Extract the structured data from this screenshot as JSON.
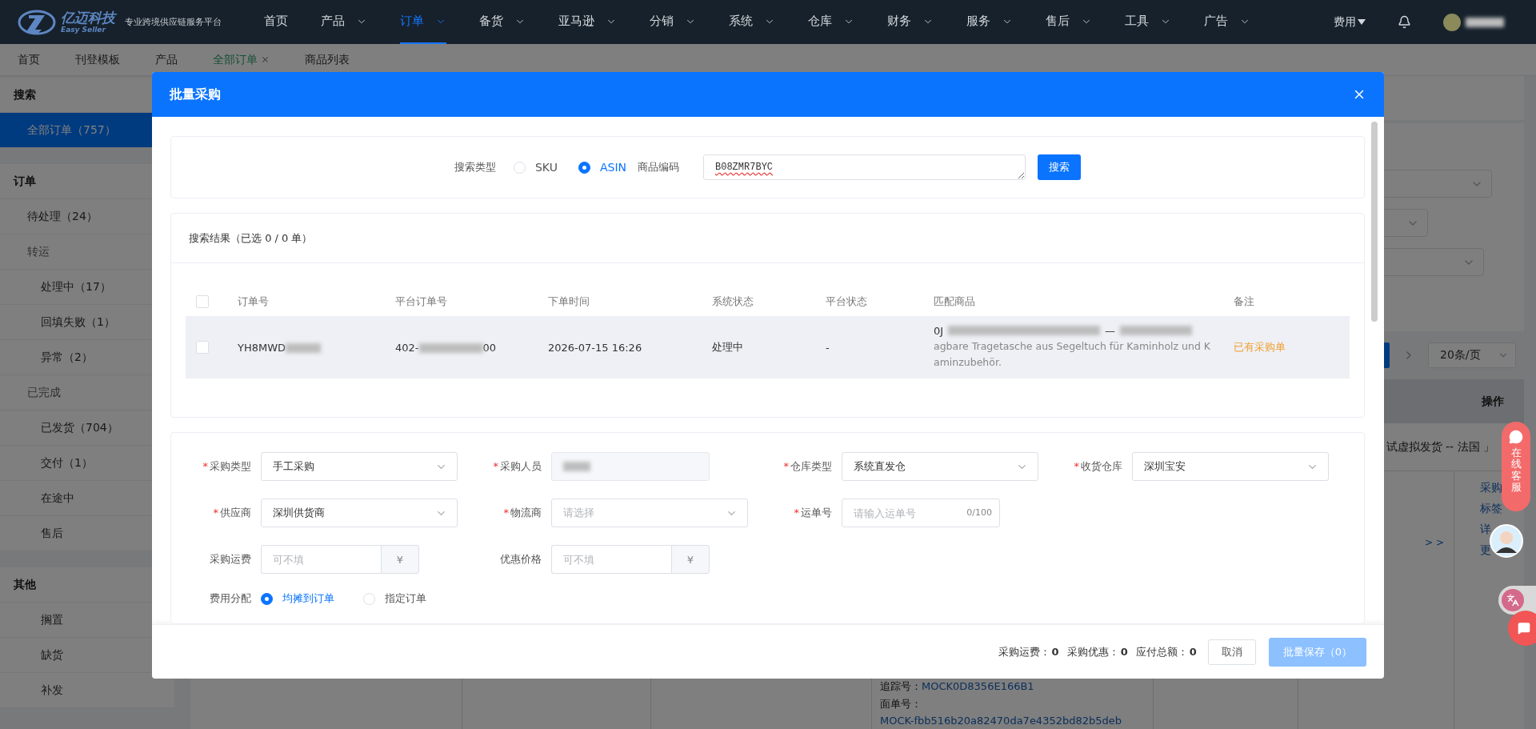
{
  "top_nav": {
    "logo": {
      "name": "亿迈科技",
      "sub": "Easy Seller"
    },
    "slogan": "专业跨境供应链服务平台",
    "items": [
      {
        "label": "首页",
        "dropdown": false,
        "selected": false
      },
      {
        "label": "产品",
        "dropdown": true,
        "selected": false
      },
      {
        "label": "订单",
        "dropdown": true,
        "selected": true
      },
      {
        "label": "备货",
        "dropdown": true,
        "selected": false
      },
      {
        "label": "亚马逊",
        "dropdown": true,
        "selected": false
      },
      {
        "label": "分销",
        "dropdown": true,
        "selected": false
      },
      {
        "label": "系统",
        "dropdown": true,
        "selected": false
      },
      {
        "label": "仓库",
        "dropdown": true,
        "selected": false
      },
      {
        "label": "财务",
        "dropdown": true,
        "selected": false
      },
      {
        "label": "服务",
        "dropdown": true,
        "selected": false
      },
      {
        "label": "售后",
        "dropdown": true,
        "selected": false
      },
      {
        "label": "工具",
        "dropdown": true,
        "selected": false
      },
      {
        "label": "广告",
        "dropdown": true,
        "selected": false
      }
    ],
    "fee_menu": "费用"
  },
  "page_tabs": [
    {
      "label": "首页",
      "selected": false,
      "closable": false
    },
    {
      "label": "刊登模板",
      "selected": false,
      "closable": false
    },
    {
      "label": "产品",
      "selected": false,
      "closable": false
    },
    {
      "label": "全部订单",
      "selected": true,
      "closable": true
    },
    {
      "label": "商品列表",
      "selected": false,
      "closable": false
    }
  ],
  "sidebar": {
    "sections": [
      {
        "title": "搜索",
        "items": [
          {
            "label": "全部订单（757）",
            "kind": "item",
            "selected": true
          }
        ]
      },
      {
        "title": "订单",
        "items": [
          {
            "label": "待处理（24）",
            "kind": "item",
            "selected": false
          },
          {
            "label": "转运",
            "kind": "group",
            "children": [
              {
                "label": "处理中（17）",
                "selected": false
              },
              {
                "label": "回填失败（1）",
                "selected": false
              },
              {
                "label": "异常（2）",
                "selected": false
              }
            ]
          },
          {
            "label": "已完成",
            "kind": "group",
            "children": [
              {
                "label": "已发货（704）",
                "selected": false
              },
              {
                "label": "交付（1）",
                "selected": false
              },
              {
                "label": "在途中",
                "selected": false
              },
              {
                "label": "售后",
                "selected": false
              }
            ]
          }
        ]
      },
      {
        "title": "其他",
        "items": [
          {
            "label": "搁置",
            "kind": "sub",
            "selected": false
          },
          {
            "label": "缺货",
            "kind": "sub",
            "selected": false
          },
          {
            "label": "补发",
            "kind": "sub",
            "selected": false
          }
        ]
      }
    ]
  },
  "background_page": {
    "page_size": "20条/页",
    "actions_header": "操作",
    "group_note": "试虚拟发货 -- 法国 」",
    "expand": "> >",
    "actions": [
      "采购",
      "标签",
      "详",
      "更"
    ],
    "tracking": [
      {
        "label": "追踪号：",
        "value": "MOCK0D8356E166B1"
      },
      {
        "label": "面单号：",
        "value": "MOCK-fbb516b20a82470da7e4352bd82b5deb"
      }
    ]
  },
  "modal": {
    "title": "批量采购",
    "search": {
      "type_label": "搜索类型",
      "types": [
        {
          "label": "SKU",
          "selected": false
        },
        {
          "label": "ASIN",
          "selected": true
        }
      ],
      "code_label": "商品编码",
      "code_value": "B08ZMR7BYC",
      "button": "搜索"
    },
    "results": {
      "title": "搜索结果（已选 0 / 0 单）",
      "all_checked": false,
      "columns": [
        "订单号",
        "平台订单号",
        "下单时间",
        "系统状态",
        "平台状态",
        "匹配商品",
        "备注"
      ],
      "rows": [
        {
          "checked": false,
          "order_no": "YH8MWD",
          "platform_order_start": "402-",
          "platform_order_end": "00",
          "time": "2026-07-15 16:26",
          "system_status": "处理中",
          "platform_status": "-",
          "product_code": "0J",
          "product_sep": "—",
          "product_title": "agbare Tragetasche aus Segeltuch für Kaminholz und Kaminzubehör.",
          "note": "已有采购单"
        }
      ]
    },
    "form": {
      "required_mark": "*",
      "rows": [
        [
          {
            "label": "采购类型",
            "required": true,
            "kind": "select",
            "value": "手工采购"
          },
          {
            "label": "采购人员",
            "required": true,
            "kind": "readonly"
          },
          {
            "label": "仓库类型",
            "required": true,
            "kind": "select",
            "value": "系统直发仓"
          },
          {
            "label": "收货仓库",
            "required": true,
            "kind": "select",
            "value": "深圳宝安"
          }
        ],
        [
          {
            "label": "供应商",
            "required": true,
            "kind": "select",
            "value": "深圳供货商"
          },
          {
            "label": "物流商",
            "required": true,
            "kind": "select",
            "placeholder": "请选择"
          },
          {
            "label": "运单号",
            "required": true,
            "kind": "text",
            "placeholder": "请输入运单号",
            "count": "0/100"
          }
        ],
        [
          {
            "label": "采购运费",
            "required": false,
            "kind": "amount",
            "placeholder": "可不填",
            "suffix": "¥"
          },
          {
            "label": "优惠价格",
            "required": false,
            "kind": "amount",
            "placeholder": "可不填",
            "suffix": "¥"
          }
        ]
      ],
      "allocation": {
        "label": "费用分配",
        "options": [
          {
            "label": "均摊到订单",
            "selected": true
          },
          {
            "label": "指定订单",
            "selected": false
          }
        ]
      }
    },
    "footer": {
      "totals": [
        {
          "label": "采购运费：",
          "value": "0"
        },
        {
          "label": "采购优惠：",
          "value": "0"
        },
        {
          "label": "应付总额：",
          "value": "0"
        }
      ],
      "cancel": "取消",
      "save": {
        "label": "批量保存（0）",
        "disabled": true
      }
    }
  },
  "service_widget": {
    "label": "在线客服"
  }
}
